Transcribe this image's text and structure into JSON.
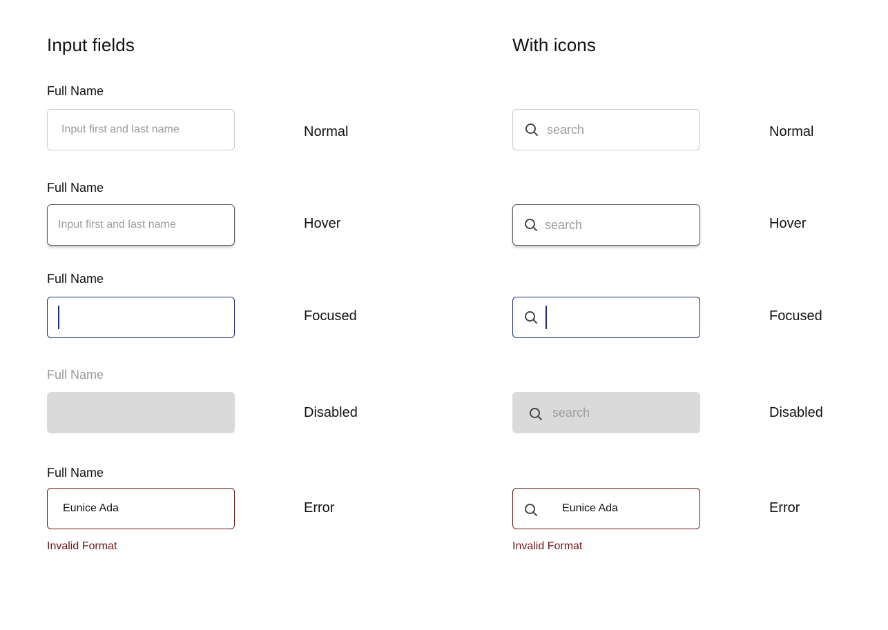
{
  "left_section": {
    "title": "Input fields",
    "field_label": "Full Name",
    "placeholder": "Input first and last name",
    "error_value": "Eunice Ada",
    "error_message": "Invalid Format"
  },
  "right_section": {
    "title": "With icons",
    "placeholder": "search",
    "error_value": "Eunice Ada",
    "error_message": "Invalid Format",
    "icon": "search-icon"
  },
  "states": {
    "normal": "Normal",
    "hover": "Hover",
    "focused": "Focused",
    "disabled": "Disabled",
    "error": "Error"
  },
  "colors": {
    "focus_border": "#1b2a7a",
    "error_border": "#6e1414",
    "disabled_fill": "#dadada",
    "normal_border": "#c9c9c9"
  }
}
